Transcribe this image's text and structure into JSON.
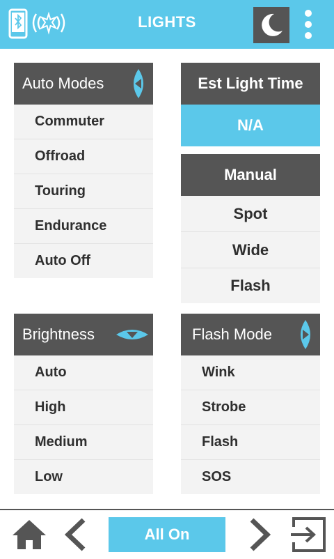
{
  "header": {
    "title": "LIGHTS"
  },
  "auto_modes": {
    "title": "Auto Modes",
    "items": [
      "Commuter",
      "Offroad",
      "Touring",
      "Endurance",
      "Auto Off"
    ]
  },
  "est_light_time": {
    "title": "Est Light Time",
    "value": "N/A"
  },
  "manual": {
    "title": "Manual",
    "items": [
      "Spot",
      "Wide",
      "Flash"
    ]
  },
  "brightness": {
    "title": "Brightness",
    "items": [
      "Auto",
      "High",
      "Medium",
      "Low"
    ]
  },
  "flash_mode": {
    "title": "Flash Mode",
    "items": [
      "Wink",
      "Strobe",
      "Flash",
      "SOS"
    ]
  },
  "footer": {
    "all_on": "All On"
  },
  "colors": {
    "accent": "#5bc8ea",
    "header_dark": "#555555",
    "item_bg": "#f3f3f3",
    "text": "#2f2f2f"
  },
  "icons": [
    "phone-bluetooth-icon",
    "light-signal-icon",
    "moon-icon",
    "kebab-menu-icon",
    "home-icon",
    "chevron-left-icon",
    "chevron-right-icon",
    "exit-icon",
    "arrow-left-icon",
    "arrow-down-icon",
    "arrow-right-icon"
  ]
}
